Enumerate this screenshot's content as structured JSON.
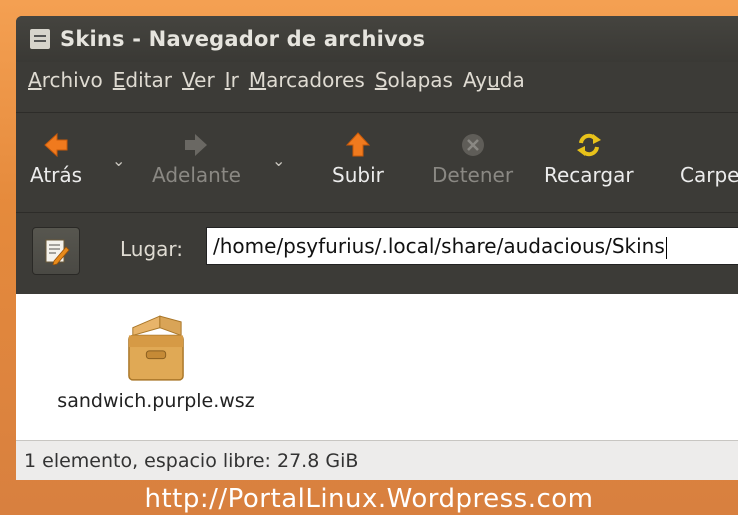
{
  "window": {
    "title": "Skins - Navegador de archivos"
  },
  "menubar": [
    {
      "pre": "",
      "accel": "A",
      "post": "rchivo"
    },
    {
      "pre": "",
      "accel": "E",
      "post": "ditar"
    },
    {
      "pre": "",
      "accel": "V",
      "post": "er"
    },
    {
      "pre": "",
      "accel": "I",
      "post": "r"
    },
    {
      "pre": "",
      "accel": "M",
      "post": "arcadores"
    },
    {
      "pre": "",
      "accel": "S",
      "post": "olapas"
    },
    {
      "pre": "Ay",
      "accel": "u",
      "post": "da"
    }
  ],
  "toolbar": {
    "back": "Atrás",
    "forward": "Adelante",
    "up": "Subir",
    "stop": "Detener",
    "reload": "Recargar",
    "computer": "Carpe"
  },
  "location": {
    "label": "Lugar:",
    "path": "/home/psyfurius/.local/share/audacious/Skins"
  },
  "files": [
    {
      "name": "sandwich.purple.wsz",
      "icon": "package-icon"
    }
  ],
  "status": "1 elemento, espacio libre: 27.8 GiB",
  "watermark": "http://PortalLinux.Wordpress.com"
}
